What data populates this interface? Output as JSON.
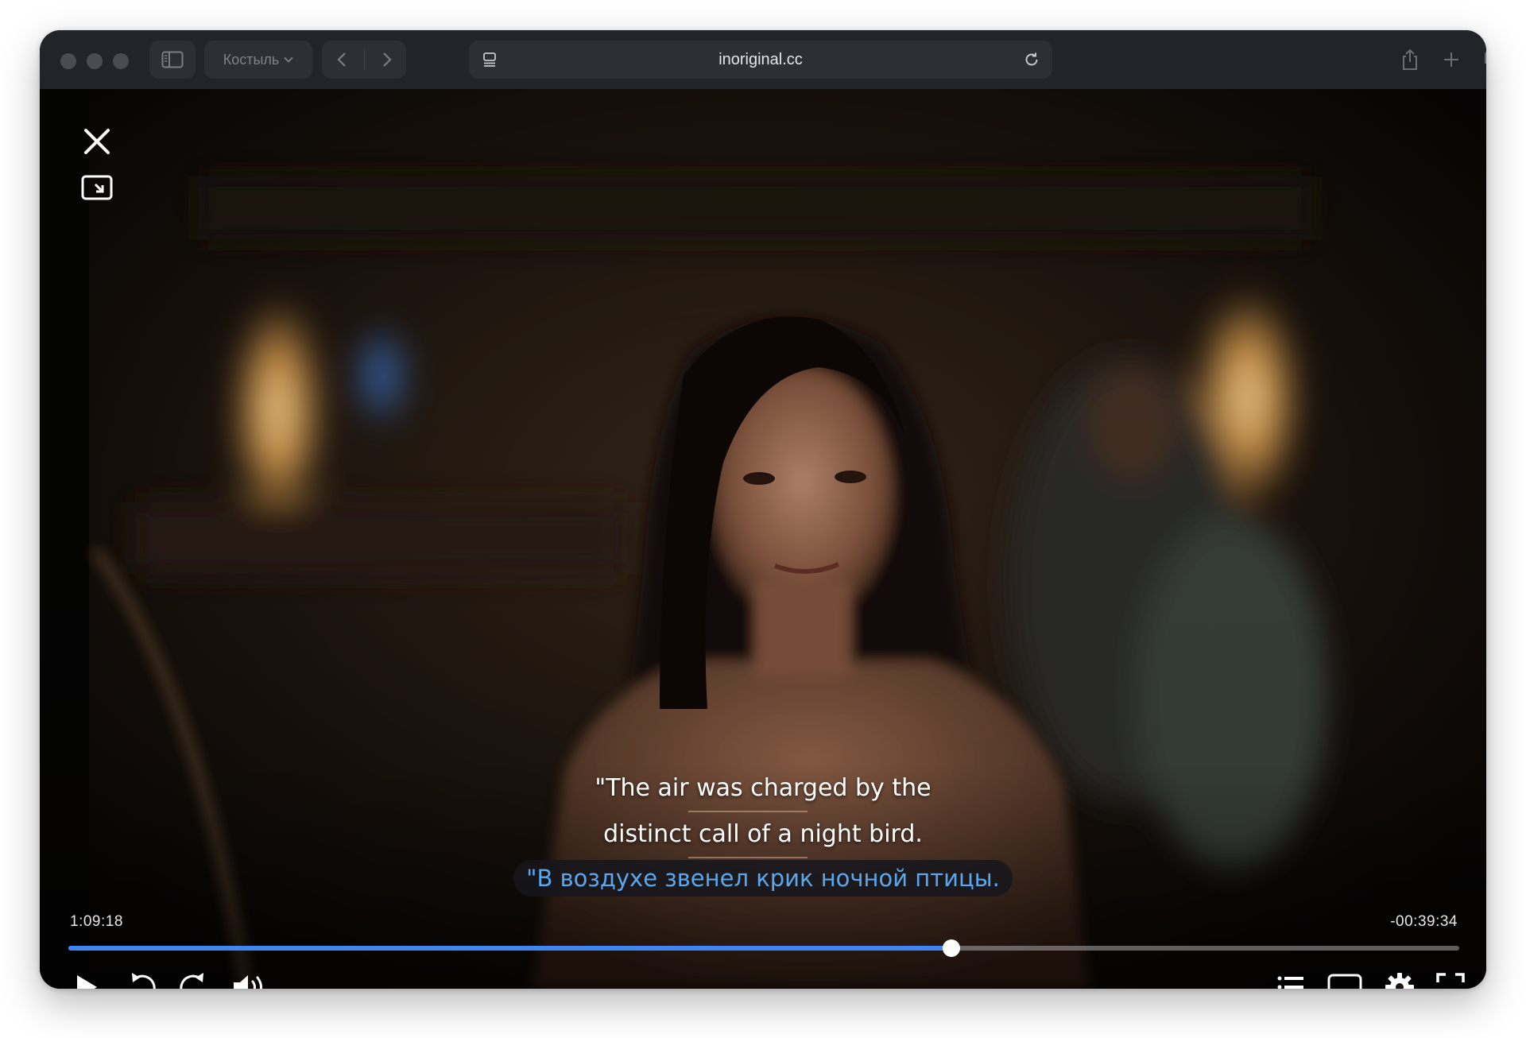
{
  "browser": {
    "profile_label": "Костыль",
    "url": "inoriginal.cc"
  },
  "player": {
    "elapsed": "1:09:18",
    "remaining": "-00:39:34",
    "progress_fraction": 0.635,
    "subtitle_en_line1": "\"The air was charged by the",
    "subtitle_en_line2": "distinct call of a night bird.",
    "subtitle_ru": "\"В воздухе звенел крик ночной птицы.",
    "accent_color": "#3f86f0",
    "translation_color": "#5aa7ee"
  },
  "icons": {
    "close": "close-icon",
    "minimize": "picture-in-picture-icon",
    "play": "play-icon",
    "rewind": "rewind-10-icon",
    "forward": "forward-10-icon",
    "volume": "volume-icon",
    "playlist": "list-icon",
    "subtitles": "subtitles-icon",
    "settings": "gear-icon",
    "fullscreen": "fullscreen-icon"
  }
}
